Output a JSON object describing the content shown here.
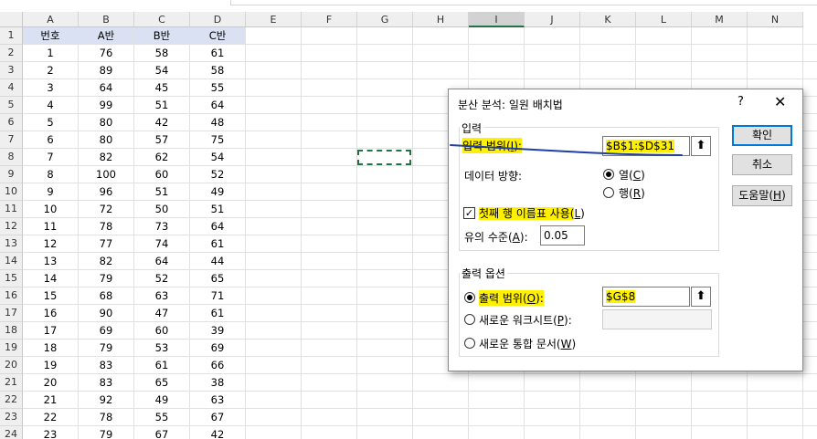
{
  "columns": [
    "A",
    "B",
    "C",
    "D",
    "E",
    "F",
    "G",
    "H",
    "I",
    "J",
    "K",
    "L",
    "M",
    "N"
  ],
  "rows": [
    "1",
    "2",
    "3",
    "4",
    "5",
    "6",
    "7",
    "8",
    "9",
    "10",
    "11",
    "12",
    "13",
    "14",
    "15",
    "16",
    "17",
    "18",
    "19",
    "20",
    "21",
    "22",
    "23",
    "24"
  ],
  "table": {
    "headers": [
      "번호",
      "A반",
      "B반",
      "C반"
    ],
    "data": [
      [
        "1",
        "76",
        "58",
        "61"
      ],
      [
        "2",
        "89",
        "54",
        "58"
      ],
      [
        "3",
        "64",
        "45",
        "55"
      ],
      [
        "4",
        "99",
        "51",
        "64"
      ],
      [
        "5",
        "80",
        "42",
        "48"
      ],
      [
        "6",
        "80",
        "57",
        "75"
      ],
      [
        "7",
        "82",
        "62",
        "54"
      ],
      [
        "8",
        "100",
        "60",
        "52"
      ],
      [
        "9",
        "96",
        "51",
        "49"
      ],
      [
        "10",
        "72",
        "50",
        "51"
      ],
      [
        "11",
        "78",
        "73",
        "64"
      ],
      [
        "12",
        "77",
        "74",
        "61"
      ],
      [
        "13",
        "82",
        "64",
        "44"
      ],
      [
        "14",
        "79",
        "52",
        "65"
      ],
      [
        "15",
        "68",
        "63",
        "71"
      ],
      [
        "16",
        "90",
        "47",
        "61"
      ],
      [
        "17",
        "69",
        "60",
        "39"
      ],
      [
        "18",
        "79",
        "53",
        "69"
      ],
      [
        "19",
        "83",
        "61",
        "66"
      ],
      [
        "20",
        "83",
        "65",
        "38"
      ],
      [
        "21",
        "92",
        "49",
        "63"
      ],
      [
        "22",
        "78",
        "55",
        "67"
      ],
      [
        "23",
        "79",
        "67",
        "42"
      ]
    ]
  },
  "dialog": {
    "title": "분산 분석: 일원 배치법",
    "help": "?",
    "close": "✕",
    "input_group": "입력",
    "input_range_label": "입력 범위(",
    "input_range_key": "I",
    "input_range_suffix": "):",
    "input_range_value": "$B$1:$D$31",
    "direction_label": "데이터 방향:",
    "dir_col_label": "열(",
    "dir_col_key": "C",
    "dir_row_label": "행(",
    "dir_row_key": "R",
    "paren_close": ")",
    "labels_checkbox": "첫째 행 이름표 사용(",
    "labels_key": "L",
    "alpha_label": "유의 수준(",
    "alpha_key": "A",
    "alpha_suffix": "):",
    "alpha_value": "0.05",
    "output_group": "출력 옵션",
    "output_range_label": "출력 범위(",
    "output_range_key": "O",
    "output_range_suffix": "):",
    "output_range_value": "$G$8",
    "new_sheet_label": "새로운 워크시트(",
    "new_sheet_key": "P",
    "new_sheet_suffix": "):",
    "new_book_label": "새로운 통합 문서(",
    "new_book_key": "W",
    "ok": "확인",
    "cancel": "취소",
    "help_button": "도움말(",
    "help_key": "H",
    "ref_icon": "⬆"
  },
  "colors": {
    "highlight": "#fff000",
    "ink": "#1f3fa8",
    "header_fill": "#d9e1f2",
    "marquee": "#217346"
  }
}
